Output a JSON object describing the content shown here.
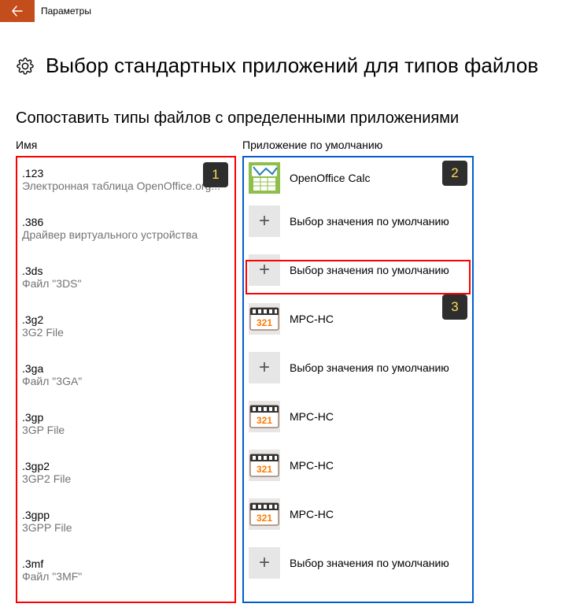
{
  "titlebar": {
    "title": "Параметры"
  },
  "page": {
    "h1": "Выбор стандартных приложений для типов файлов",
    "h2": "Сопоставить типы файлов с определенными приложениями"
  },
  "columns": {
    "name": "Имя",
    "app": "Приложение по умолчанию"
  },
  "strings": {
    "choose_default": "Выбор значения по умолчанию"
  },
  "steps": {
    "one": "1",
    "two": "2",
    "three": "3"
  },
  "rows": [
    {
      "ext": ".123",
      "desc": "Электронная таблица OpenOffice.org...",
      "app_kind": "calc",
      "app_label": "OpenOffice Calc"
    },
    {
      "ext": ".386",
      "desc": "Драйвер виртуального устройства",
      "app_kind": "none",
      "app_label": "Выбор значения по умолчанию"
    },
    {
      "ext": ".3ds",
      "desc": "Файл \"3DS\"",
      "app_kind": "none",
      "app_label": "Выбор значения по умолчанию"
    },
    {
      "ext": ".3g2",
      "desc": "3G2 File",
      "app_kind": "mpc",
      "app_label": "MPC-HC"
    },
    {
      "ext": ".3ga",
      "desc": "Файл \"3GA\"",
      "app_kind": "none",
      "app_label": "Выбор значения по умолчанию"
    },
    {
      "ext": ".3gp",
      "desc": "3GP File",
      "app_kind": "mpc",
      "app_label": "MPC-HC"
    },
    {
      "ext": ".3gp2",
      "desc": "3GP2 File",
      "app_kind": "mpc",
      "app_label": "MPC-HC"
    },
    {
      "ext": ".3gpp",
      "desc": "3GPP File",
      "app_kind": "mpc",
      "app_label": "MPC-HC"
    },
    {
      "ext": ".3mf",
      "desc": "Файл \"3MF\"",
      "app_kind": "none",
      "app_label": "Выбор значения по умолчанию"
    }
  ]
}
